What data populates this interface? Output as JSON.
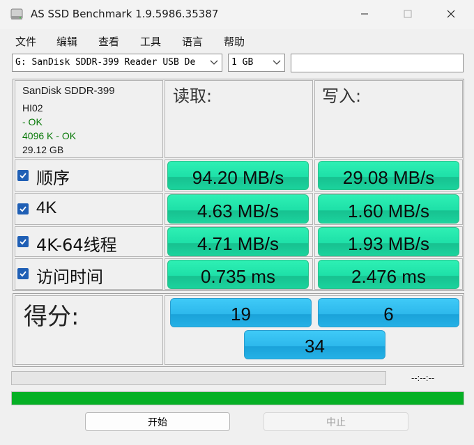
{
  "window": {
    "title": "AS SSD Benchmark 1.9.5986.35387"
  },
  "menu": [
    "文件",
    "编辑",
    "查看",
    "工具",
    "语言",
    "帮助"
  ],
  "toolbar": {
    "drive": "G: SanDisk SDDR-399 Reader USB De",
    "size": "1 GB",
    "extra_value": ""
  },
  "device": {
    "name": "SanDisk SDDR-399",
    "firmware": "HI02",
    "status1": " - OK",
    "status2": "4096 K - OK",
    "capacity": "29.12 GB"
  },
  "columns": {
    "read": "读取:",
    "write": "写入:"
  },
  "rows": [
    {
      "label": "顺序",
      "read": "94.20 MB/s",
      "write": "29.08 MB/s",
      "checked": true
    },
    {
      "label": "4K",
      "read": "4.63 MB/s",
      "write": "1.60 MB/s",
      "checked": true
    },
    {
      "label": "4K-64线程",
      "read": "4.71 MB/s",
      "write": "1.93 MB/s",
      "checked": true
    },
    {
      "label": "访问时间",
      "read": "0.735 ms",
      "write": "2.476 ms",
      "checked": true
    }
  ],
  "score": {
    "label": "得分:",
    "read": "19",
    "write": "6",
    "total": "34"
  },
  "progress": {
    "time_text": "--:--:--",
    "top_fraction": 0,
    "main_fraction": 1
  },
  "buttons": {
    "start": "开始",
    "stop": "中止"
  },
  "colors": {
    "result_green": "#1ee0a8",
    "score_blue": "#2db8ec",
    "progress_green": "#06b025",
    "ok_text": "#0a7a0a",
    "checkbox_blue": "#1f5fb5"
  }
}
